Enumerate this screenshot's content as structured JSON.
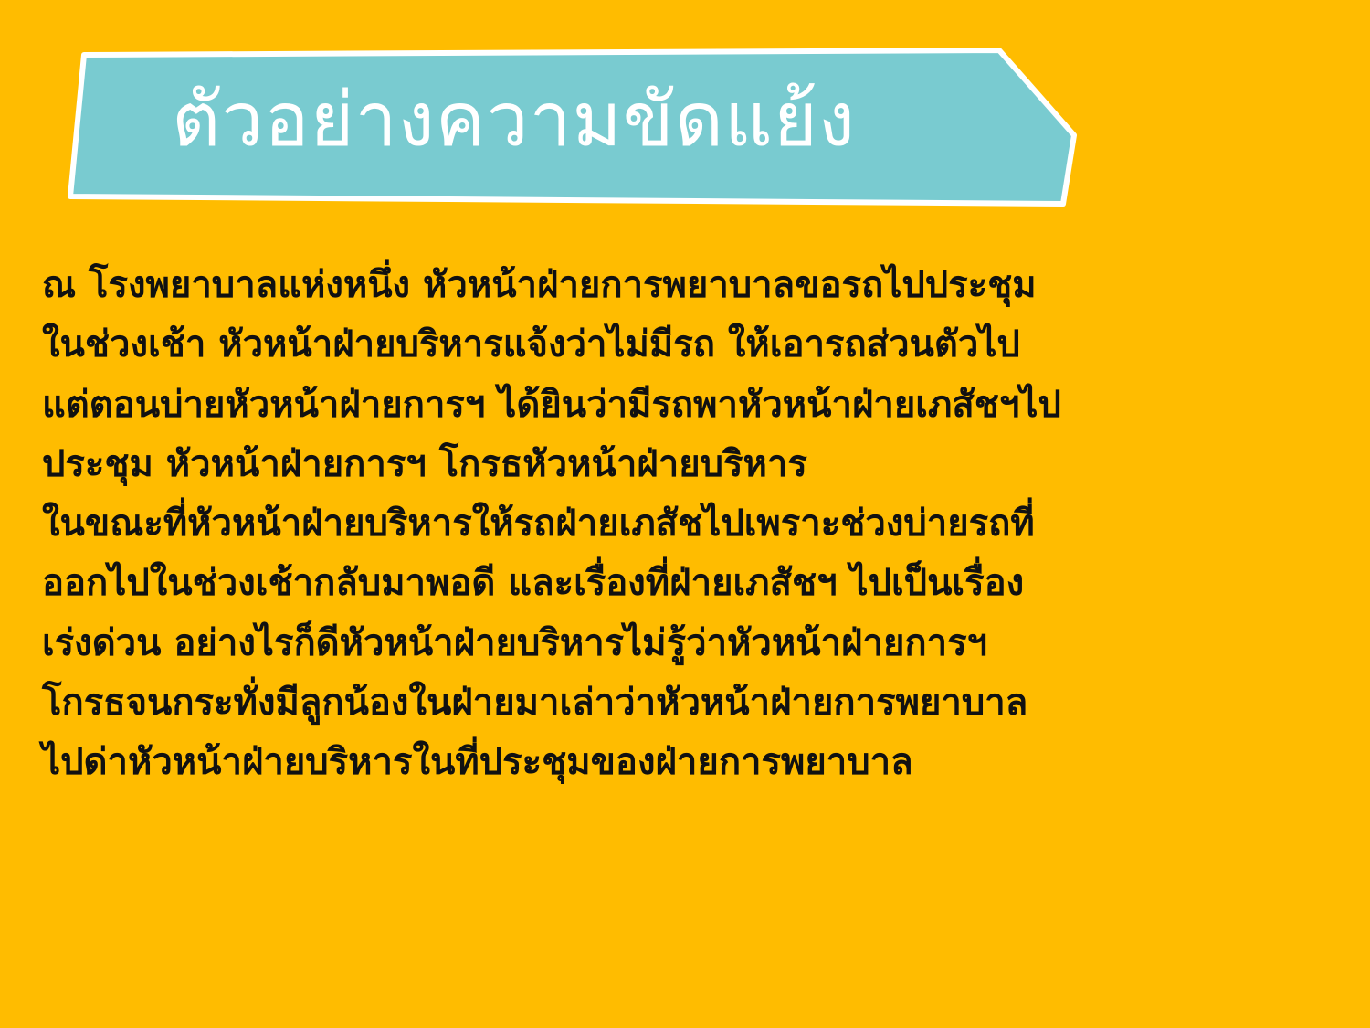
{
  "colors": {
    "background": "#ffbc00",
    "banner_fill": "#79cbd0",
    "banner_border": "#ffffff",
    "title_text": "#ffffff",
    "body_text": "#111111"
  },
  "slide": {
    "title": "ตัวอย่างความขัดแย้ง",
    "lines": [
      "ณ โรงพยาบาลแห่งหนึ่ง หัวหน้าฝ่ายการพยาบาลขอรถไปประชุม",
      "ในช่วงเช้า หัวหน้าฝ่ายบริหารแจ้งว่าไม่มีรถ ให้เอารถส่วนตัวไป",
      "แต่ตอนบ่ายหัวหน้าฝ่ายการฯ ได้ยินว่ามีรถพาหัวหน้าฝ่ายเภสัชฯไป",
      "ประชุม หัวหน้าฝ่ายการฯ โกรธหัวหน้าฝ่ายบริหาร",
      "ในขณะที่หัวหน้าฝ่ายบริหารให้รถฝ่ายเภสัชไปเพราะช่วงบ่ายรถที่",
      "ออกไปในช่วงเช้ากลับมาพอดี และเรื่องที่ฝ่ายเภสัชฯ ไปเป็นเรื่อง",
      "เร่งด่วน อย่างไรก็ดีหัวหน้าฝ่ายบริหารไม่รู้ว่าหัวหน้าฝ่ายการฯ",
      "โกรธจนกระทั่งมีลูกน้องในฝ่ายมาเล่าว่าหัวหน้าฝ่ายการพยาบาล",
      "ไปด่าหัวหน้าฝ่ายบริหารในที่ประชุมของฝ่ายการพยาบาล"
    ]
  }
}
